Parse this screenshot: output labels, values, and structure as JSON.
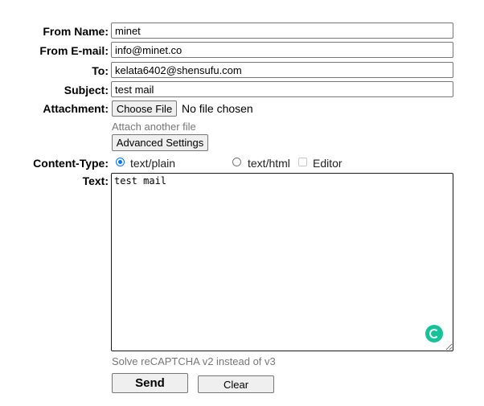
{
  "form": {
    "from_name": {
      "label": "From Name:",
      "value": "minet"
    },
    "from_email": {
      "label": "From E-mail:",
      "value": "info@minet.co"
    },
    "to": {
      "label": "To:",
      "value": "kelata6402@shensufu.com"
    },
    "subject": {
      "label": "Subject:",
      "value": "test mail"
    },
    "attachment": {
      "label": "Attachment:",
      "choose_button": "Choose File",
      "status": "No file chosen",
      "attach_another": "Attach another file",
      "advanced_button": "Advanced Settings"
    },
    "content_type": {
      "label": "Content-Type:",
      "options": [
        {
          "label": "text/plain",
          "selected": true
        },
        {
          "label": "text/html",
          "selected": false
        }
      ],
      "editor_label": "Editor",
      "editor_checked": false
    },
    "text": {
      "label": "Text:",
      "value": "test mail"
    },
    "recaptcha_link": "Solve reCAPTCHA v2 instead of v3",
    "send_button": "Send",
    "clear_button": "Clear"
  },
  "colors": {
    "radio_accent": "#0075ff",
    "grammarly": "#15c39a",
    "hint": "#777777"
  },
  "icons": [
    "grammarly-icon"
  ]
}
